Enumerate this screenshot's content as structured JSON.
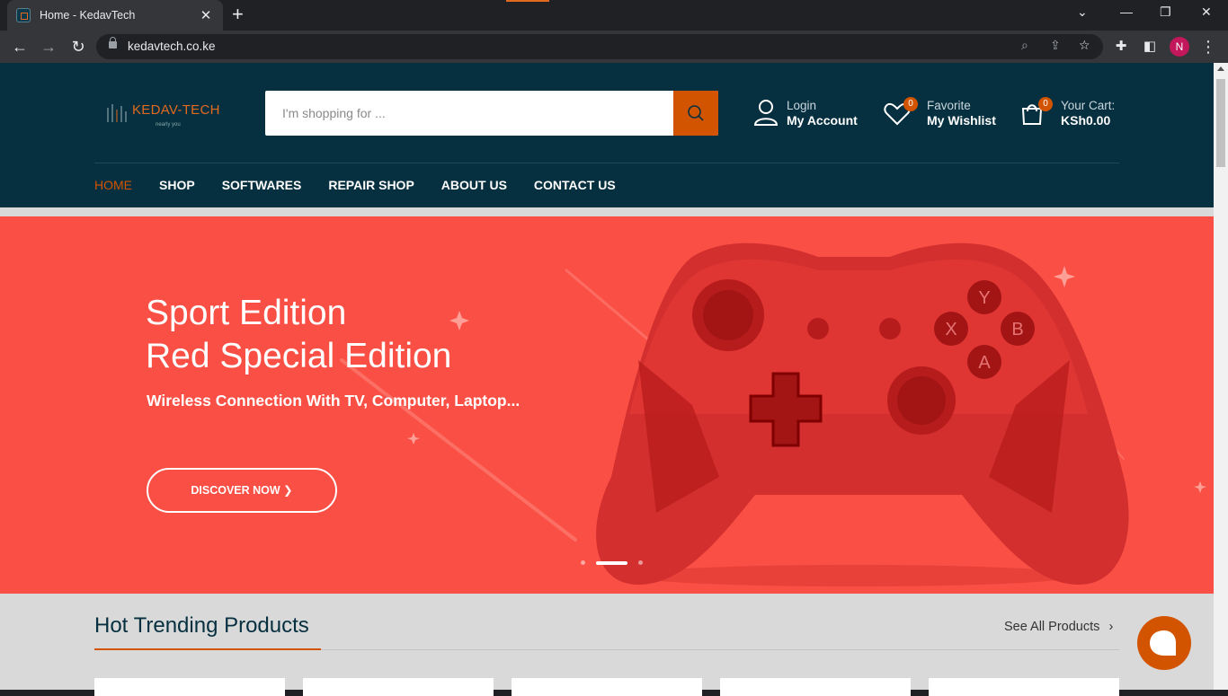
{
  "browser": {
    "tab_title": "Home - KedavTech",
    "url": "kedavtech.co.ke",
    "profile_initial": "N"
  },
  "site": {
    "logo_text": "KEDAV-TECH",
    "logo_tagline": "nearly you",
    "search_placeholder": "I'm shopping for ...",
    "account": {
      "line1": "Login",
      "line2": "My Account"
    },
    "wishlist": {
      "line1": "Favorite",
      "line2": "My Wishlist",
      "count": "0"
    },
    "cart": {
      "line1": "Your Cart:",
      "line2": "KSh0.00",
      "count": "0"
    },
    "nav": [
      "HOME",
      "SHOP",
      "SOFTWARES",
      "REPAIR SHOP",
      "ABOUT US",
      "CONTACT US"
    ],
    "nav_active": "HOME"
  },
  "hero": {
    "title_line1": "Sport Edition",
    "title_line2": "Red Special Edition",
    "subtitle": "Wireless Connection With TV, Computer, Laptop...",
    "button": "DISCOVER NOW",
    "slides": 3,
    "active_slide": 2
  },
  "products": {
    "title": "Hot Trending Products",
    "see_all": "See All Products"
  },
  "colors": {
    "header_bg": "#063040",
    "accent": "#d35400",
    "hero_bg": "#fa4f44"
  }
}
